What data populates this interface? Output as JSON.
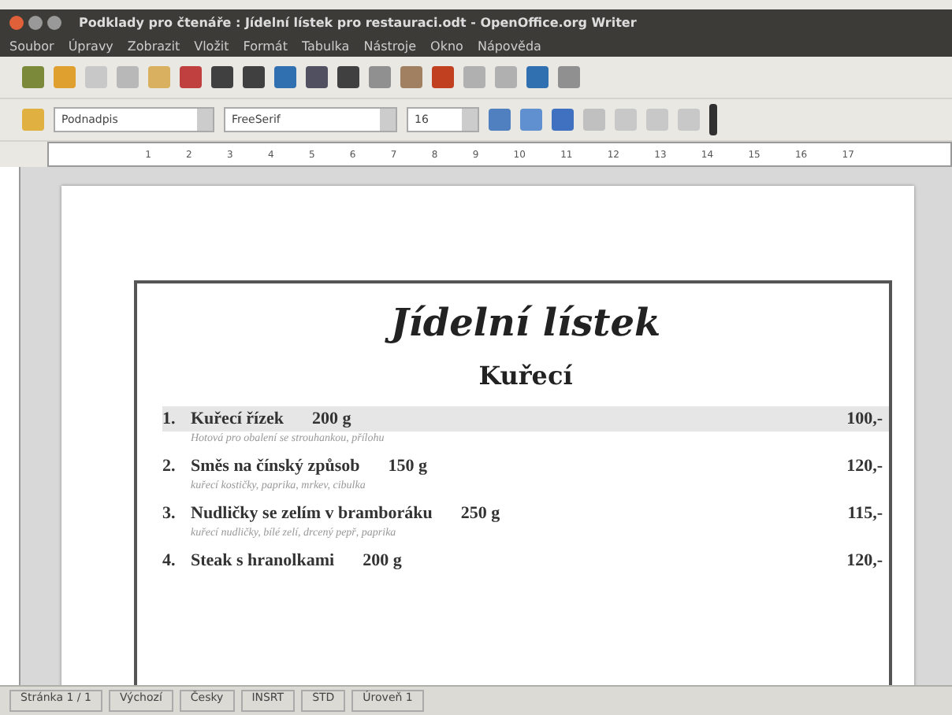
{
  "window": {
    "title": "Podklady pro čtenáře : Jídelní lístek pro restauraci.odt - OpenOffice.org Writer"
  },
  "menu": [
    "Soubor",
    "Úpravy",
    "Zobrazit",
    "Vložit",
    "Formát",
    "Tabulka",
    "Nástroje",
    "Okno",
    "Nápověda"
  ],
  "formatting": {
    "style": "Podnadpis",
    "font": "FreeSerif",
    "size": "16"
  },
  "ruler": [
    "1",
    "2",
    "3",
    "4",
    "5",
    "6",
    "7",
    "8",
    "9",
    "10",
    "11",
    "12",
    "13",
    "14",
    "15",
    "16",
    "17"
  ],
  "document": {
    "title": "Jídelní lístek",
    "heading": "Kuřecí",
    "items": [
      {
        "number": "1.",
        "name": "Kuřecí řízek",
        "weight": "200 g",
        "price": "100,-",
        "note": "Hotová pro obalení se strouhankou, přílohu",
        "selected": true
      },
      {
        "number": "2.",
        "name": "Směs na čínský způsob",
        "weight": "150 g",
        "price": "120,-",
        "note": "kuřecí kostičky, paprika, mrkev, cibulka",
        "selected": false
      },
      {
        "number": "3.",
        "name": "Nudličky se zelím v bramboráku",
        "weight": "250 g",
        "price": "115,-",
        "note": "kuřecí nudličky, bílé zelí, drcený pepř, paprika",
        "selected": false
      },
      {
        "number": "4.",
        "name": "Steak s hranolkami",
        "weight": "200 g",
        "price": "120,-",
        "selected": false
      }
    ]
  },
  "status_bar": [
    "Stránka 1 / 1",
    "Výchozí",
    "Česky",
    "INSRT",
    "STD",
    "Úroveň 1"
  ]
}
